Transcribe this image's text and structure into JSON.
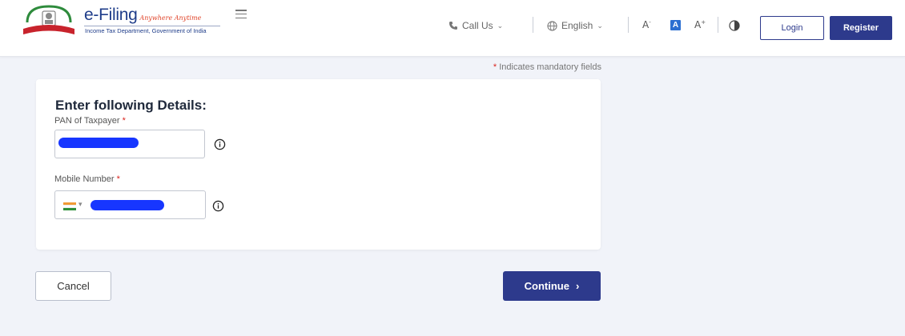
{
  "header": {
    "logo": {
      "title": "e-Filing",
      "tagline": "Anywhere Anytime",
      "subtitle": "Income Tax Department, Government of India"
    },
    "call_us": "Call Us",
    "language": "English",
    "font_decrease": "A",
    "font_decrease_sup": "-",
    "font_default": "A",
    "font_increase": "A",
    "font_increase_sup": "+",
    "login": "Login",
    "register": "Register"
  },
  "mandatory_note": {
    "star": "*",
    "text": "Indicates mandatory fields"
  },
  "form": {
    "title": "Enter following Details:",
    "pan_label": "PAN of Taxpayer",
    "mobile_label": "Mobile Number",
    "required_mark": "*",
    "pan_value": "",
    "mobile_value": "",
    "country_flag": "India"
  },
  "actions": {
    "cancel": "Cancel",
    "continue": "Continue",
    "continue_arrow": "›"
  },
  "colors": {
    "primary": "#2d3a8c",
    "required": "#d9231d",
    "page_background": "#f1f3f9",
    "redaction": "#1736ff"
  }
}
